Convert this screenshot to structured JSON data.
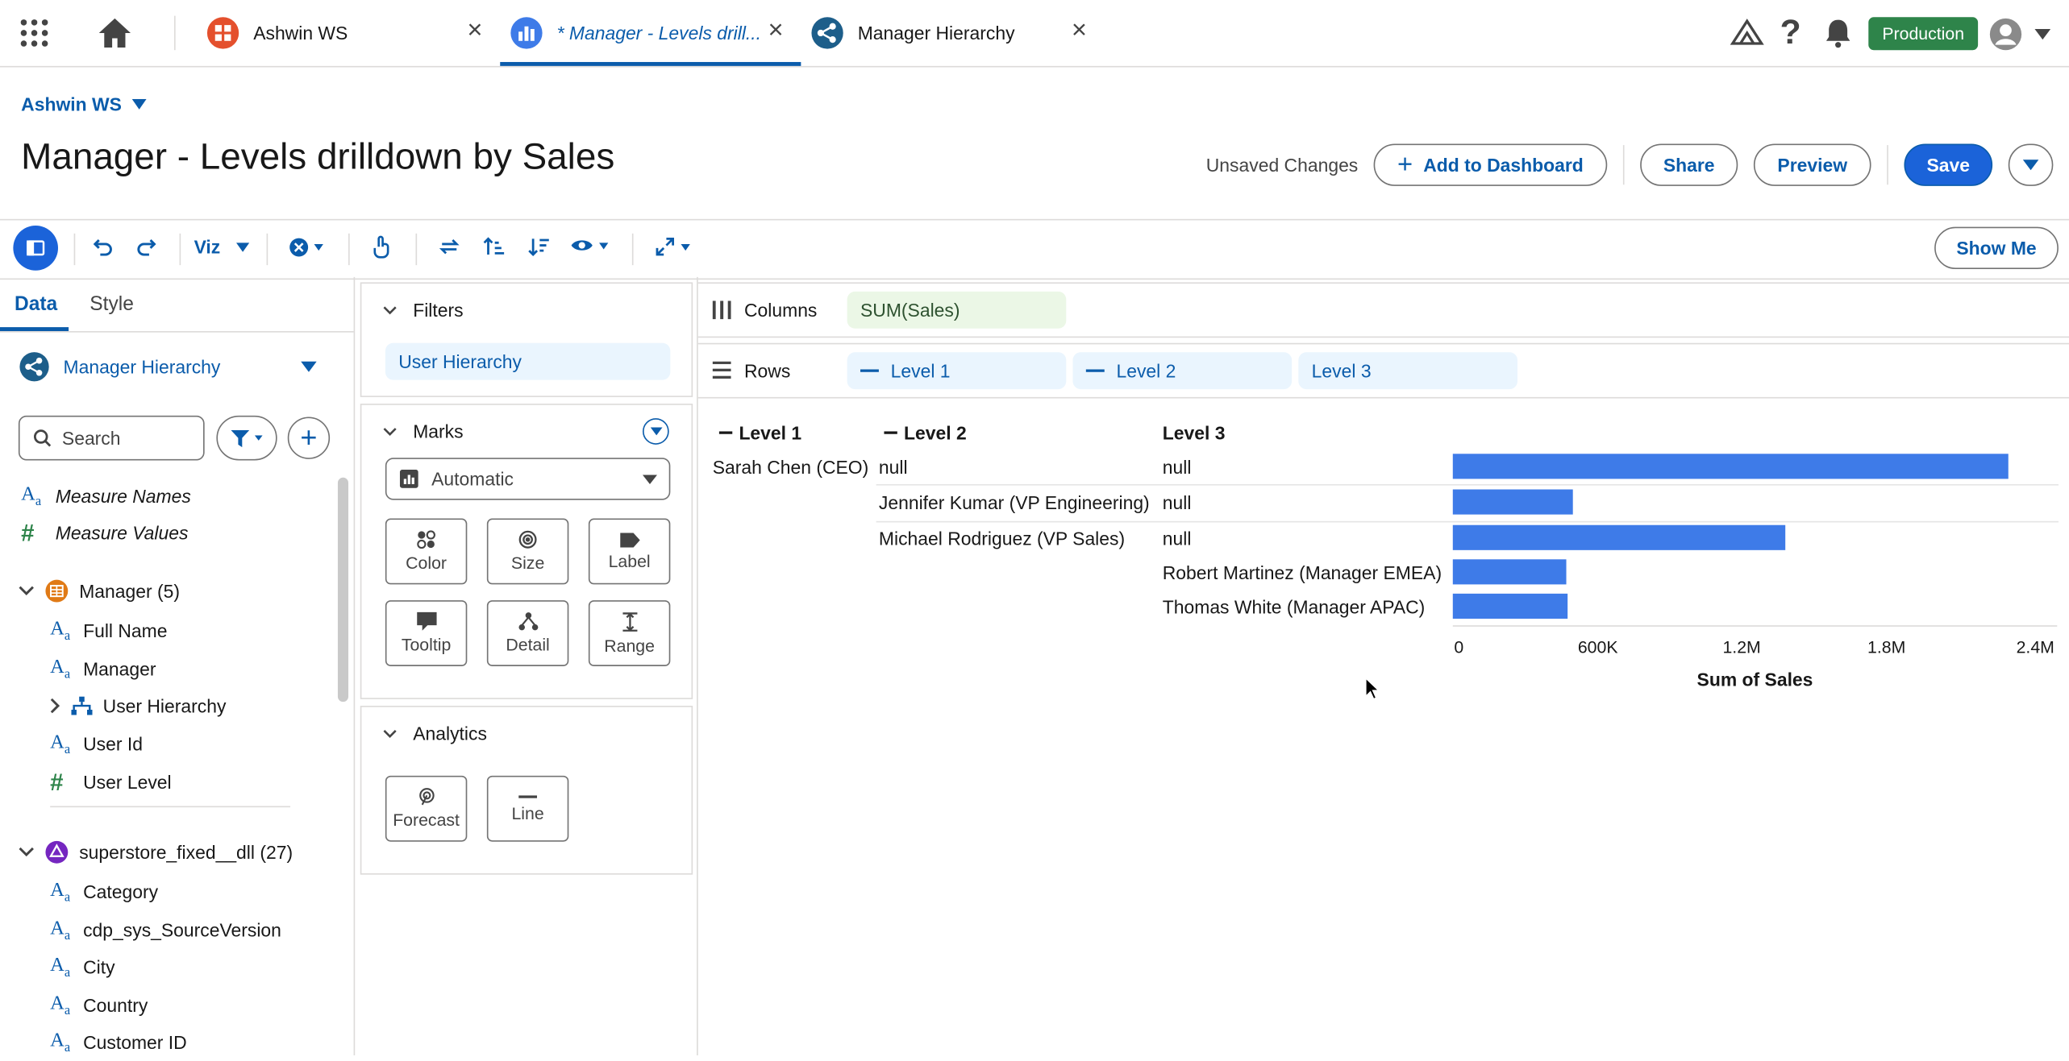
{
  "tabs": [
    {
      "title": "Ashwin WS",
      "italic": false
    },
    {
      "title": "* Manager - Levels drill...",
      "italic": true
    },
    {
      "title": "Manager Hierarchy",
      "italic": false
    }
  ],
  "topbar": {
    "environment": "Production"
  },
  "workspace": "Ashwin WS",
  "page_title": "Manager - Levels drilldown by Sales",
  "status": "Unsaved Changes",
  "actions": {
    "add": "Add to Dashboard",
    "share": "Share",
    "preview": "Preview",
    "save": "Save"
  },
  "toolbar": {
    "viz": "Viz",
    "show_me": "Show Me"
  },
  "left_tabs": [
    "Data",
    "Style"
  ],
  "datasource": "Manager Hierarchy",
  "search_placeholder": "Search",
  "top_fields": [
    "Measure Names",
    "Measure Values"
  ],
  "groups": [
    {
      "name": "Manager (5)",
      "fields": [
        "Full Name",
        "Manager",
        "User Hierarchy",
        "User Id",
        "User Level"
      ]
    },
    {
      "name": "superstore_fixed__dll (27)",
      "fields": [
        "Category",
        "cdp_sys_SourceVersion",
        "City",
        "Country",
        "Customer ID"
      ]
    }
  ],
  "filters": {
    "title": "Filters",
    "items": [
      "User Hierarchy"
    ]
  },
  "marks": {
    "title": "Marks",
    "type": "Automatic",
    "buttons": [
      "Color",
      "Size",
      "Label",
      "Tooltip",
      "Detail",
      "Range"
    ]
  },
  "analytics": {
    "title": "Analytics",
    "buttons": [
      "Forecast",
      "Line"
    ]
  },
  "shelves": {
    "columns_label": "Columns",
    "columns": [
      "SUM(Sales)"
    ],
    "rows_label": "Rows",
    "rows": [
      "Level 1",
      "Level 2",
      "Level 3"
    ]
  },
  "table_headers": [
    "Level 1",
    "Level 2",
    "Level 3"
  ],
  "table_rows": [
    {
      "l1": "Sarah Chen (CEO)",
      "l2": "null",
      "l3": "null"
    },
    {
      "l1": "",
      "l2": "Jennifer Kumar (VP Engineering)",
      "l3": "null"
    },
    {
      "l1": "",
      "l2": "Michael Rodriguez (VP Sales)",
      "l3": "null"
    },
    {
      "l1": "",
      "l2": "",
      "l3": "Robert Martinez (Manager EMEA)"
    },
    {
      "l1": "",
      "l2": "",
      "l3": "Thomas White (Manager APAC)"
    }
  ],
  "chart_data": {
    "type": "bar",
    "orientation": "horizontal",
    "categories": [
      "Sarah Chen (CEO)",
      "Jennifer Kumar (VP Engineering)",
      "Michael Rodriguez (VP Sales)",
      "Robert Martinez (Manager EMEA)",
      "Thomas White (Manager APAC)"
    ],
    "values": [
      2300000,
      500000,
      1380000,
      470000,
      475000
    ],
    "xlabel": "Sum of Sales",
    "xlim": [
      0,
      2400000
    ],
    "ticks": [
      "0",
      "600K",
      "1.2M",
      "1.8M",
      "2.4M"
    ],
    "bar_color": "#3e7be8"
  }
}
